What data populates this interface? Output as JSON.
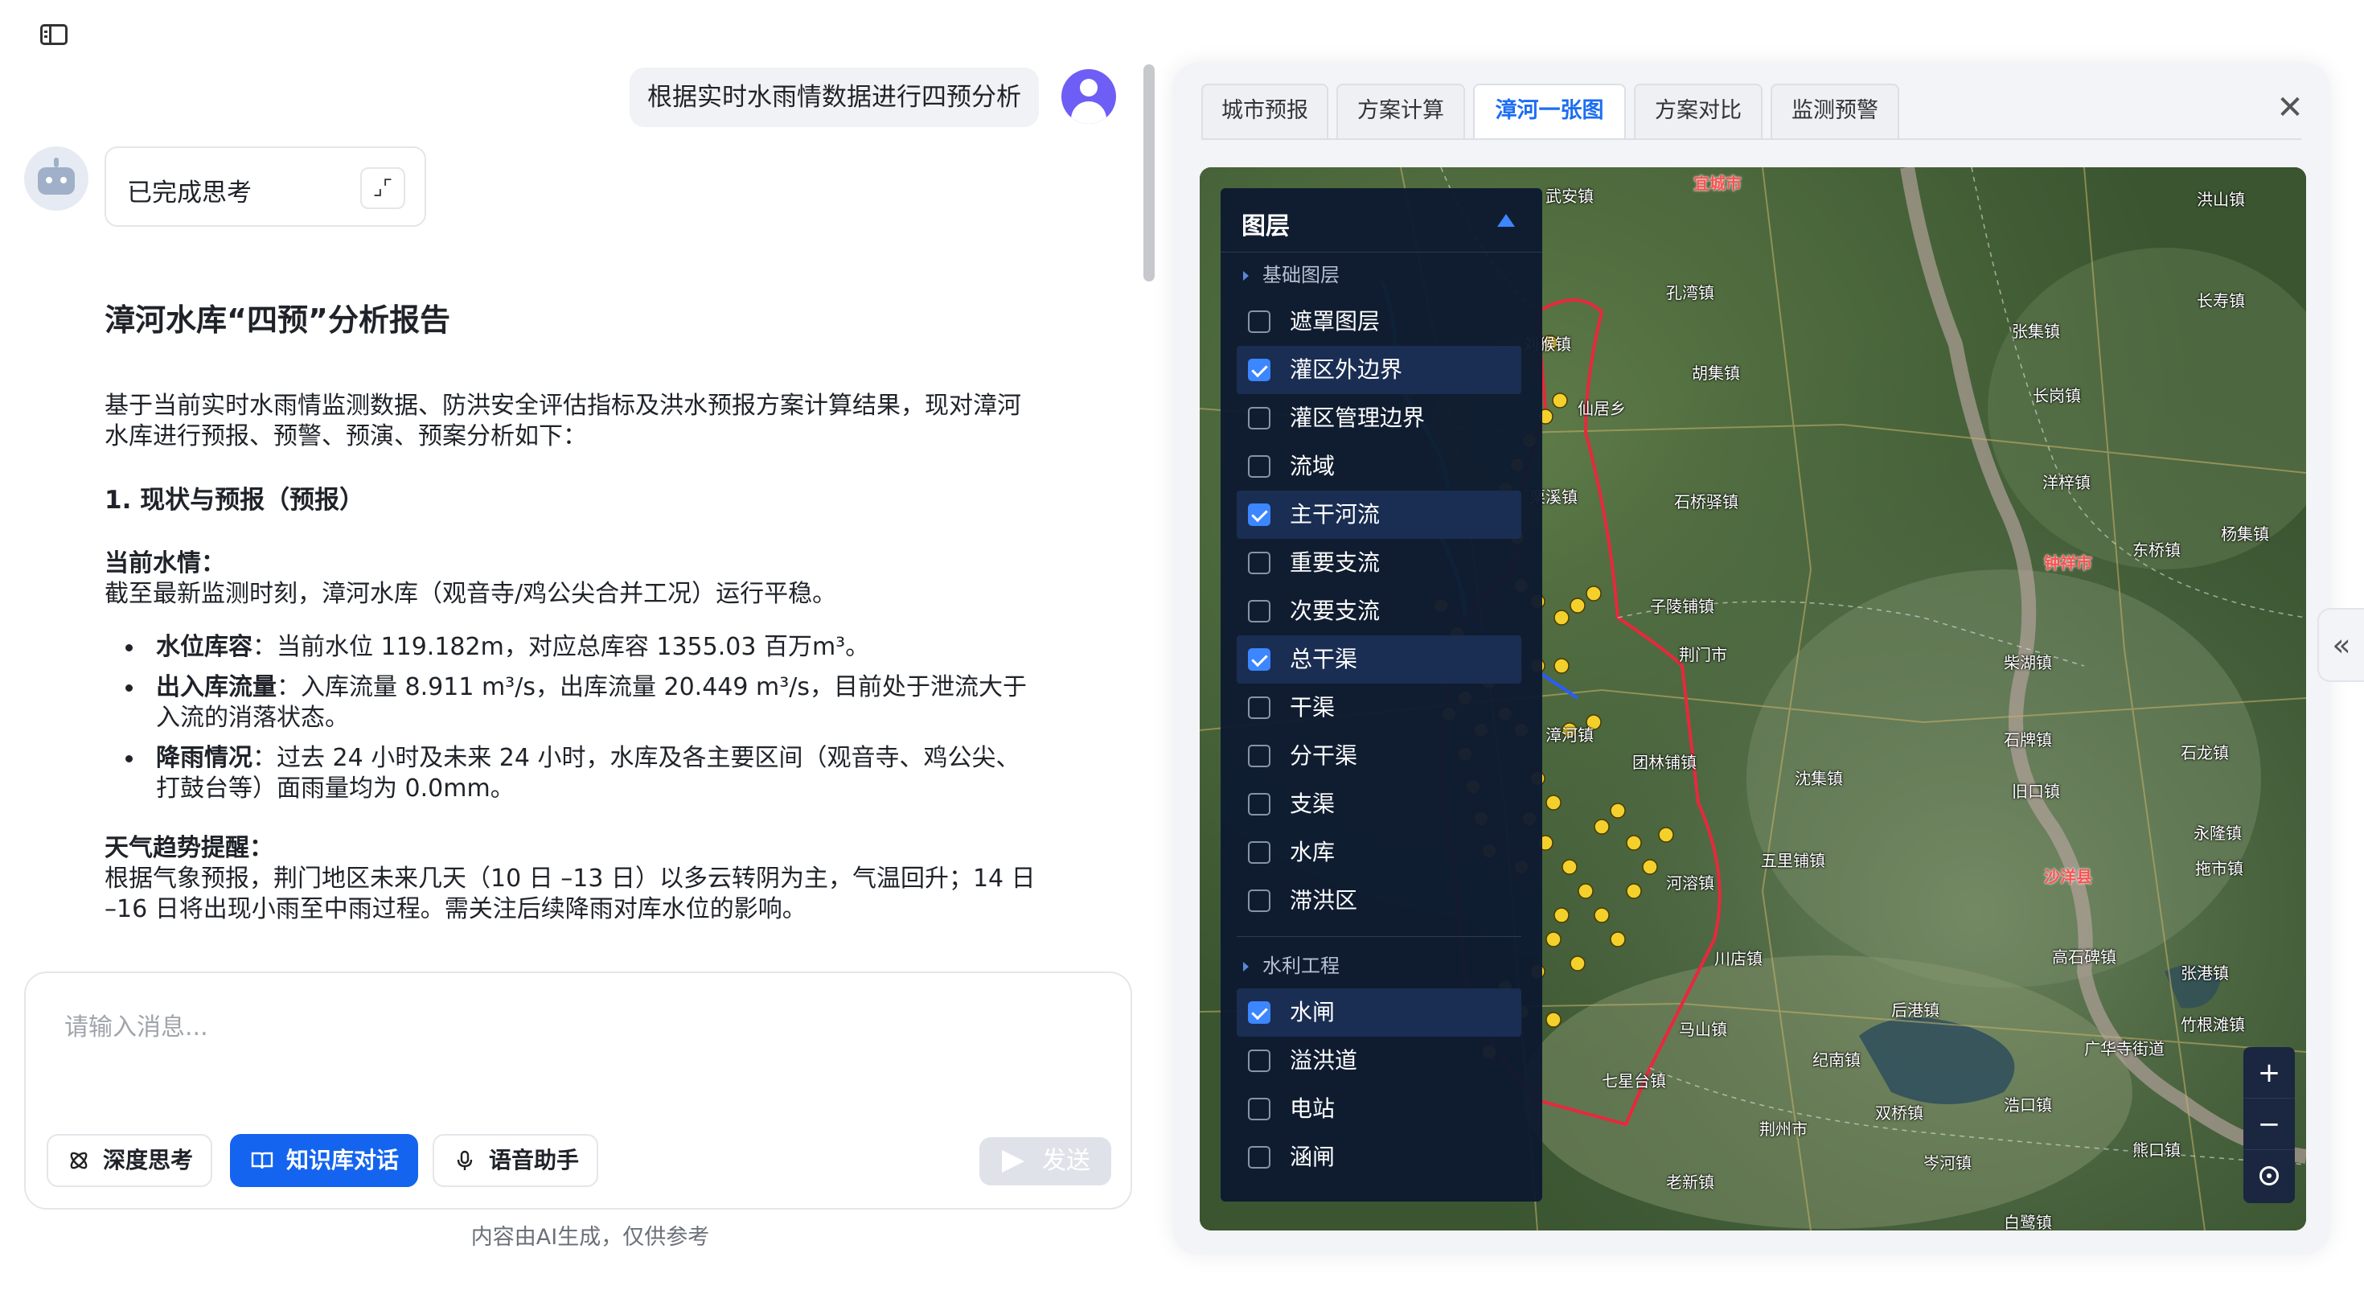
{
  "chat": {
    "user_message": "根据实时水雨情数据进行四预分析",
    "thinking_label": "已完成思考",
    "collapse_icon": "collapse-icon",
    "report": {
      "title": "漳河水库“四预”分析报告",
      "intro": "基于当前实时水雨情监测数据、防洪安全评估指标及洪水预报方案计算结果，现对漳河水库进行预报、预警、预演、预案分析如下：",
      "section1_title": "1. 现状与预报（预报）",
      "current_label": "当前水情：",
      "current_text": "截至最新监测时刻，漳河水库（观音寺/鸡公尖合并工况）运行平稳。",
      "bullets": [
        {
          "label": "水位库容",
          "text": "：当前水位 119.182m，对应总库容 1355.03 百万m³。"
        },
        {
          "label": "出入库流量",
          "text": "：入库流量 8.911 m³/s，出库流量 20.449 m³/s，目前处于泄流大于入流的消落状态。"
        },
        {
          "label": "降雨情况",
          "text": "：过去 24 小时及未来 24 小时，水库及各主要区间（观音寺、鸡公尖、打鼓台等）面雨量均为 0.0mm。"
        }
      ],
      "weather_label": "天气趋势提醒：",
      "weather_text": "根据气象预报，荆门地区未来几天（10 日 –13 日）以多云转阴为主，气温回升；14 日 –16 日将出现小雨至中雨过程。需关注后续降雨对库水位的影响。"
    },
    "input_placeholder": "请输入消息...",
    "buttons": {
      "deep_think": "深度思考",
      "knowledge": "知识库对话",
      "voice": "语音助手",
      "send": "发送"
    },
    "disclaimer": "内容由AI生成，仅供参考"
  },
  "panel": {
    "tabs": [
      "城市预报",
      "方案计算",
      "漳河一张图",
      "方案对比",
      "监测预警"
    ],
    "active_tab": "漳河一张图",
    "layers": {
      "title": "图层",
      "groups": [
        {
          "name": "基础图层",
          "items": [
            {
              "label": "遮罩图层",
              "checked": false
            },
            {
              "label": "灌区外边界",
              "checked": true
            },
            {
              "label": "灌区管理边界",
              "checked": false
            },
            {
              "label": "流域",
              "checked": false
            },
            {
              "label": "主干河流",
              "checked": true
            },
            {
              "label": "重要支流",
              "checked": false
            },
            {
              "label": "次要支流",
              "checked": false
            },
            {
              "label": "总干渠",
              "checked": true
            },
            {
              "label": "干渠",
              "checked": false
            },
            {
              "label": "分干渠",
              "checked": false
            },
            {
              "label": "支渠",
              "checked": false
            },
            {
              "label": "水库",
              "checked": false
            },
            {
              "label": "滞洪区",
              "checked": false
            }
          ]
        },
        {
          "name": "水利工程",
          "items": [
            {
              "label": "水闸",
              "checked": true
            },
            {
              "label": "溢洪道",
              "checked": false
            },
            {
              "label": "电站",
              "checked": false
            },
            {
              "label": "涵闸",
              "checked": false
            }
          ]
        }
      ]
    },
    "map_labels": {
      "towns": [
        "武安镇",
        "宜城市",
        "洪山镇",
        "孔湾镇",
        "刘猴镇",
        "胡集镇",
        "张集镇",
        "长寿镇",
        "仙居乡",
        "长岗镇",
        "栗溪镇",
        "石桥驿镇",
        "洋梓镇",
        "钟祥市",
        "东桥镇",
        "杨集镇",
        "子陵铺镇",
        "荆门市",
        "柴湖镇",
        "漳河镇",
        "团林铺镇",
        "沈集镇",
        "石牌镇",
        "石龙镇",
        "旧口镇",
        "永隆镇",
        "拖市镇",
        "河溶镇",
        "五里铺镇",
        "沙洋县",
        "川店镇",
        "高石碑镇",
        "张港镇",
        "后港镇",
        "竹根滩镇",
        "广华寺街道",
        "马山镇",
        "纪南镇",
        "七星台镇",
        "荆州市",
        "双桥镇",
        "浩口镇",
        "熊口镇",
        "岑河镇",
        "老新镇",
        "白鹭镇"
      ]
    },
    "zoom_in": "+",
    "zoom_out": "−"
  },
  "colors": {
    "accent": "#1464f0",
    "tab_active": "#1c6df3",
    "layer_panel_bg": "#0e1a30",
    "boundary": "#e8283c",
    "main_river": "#2ec4c4",
    "sluice_marker": "#f3d02c"
  }
}
